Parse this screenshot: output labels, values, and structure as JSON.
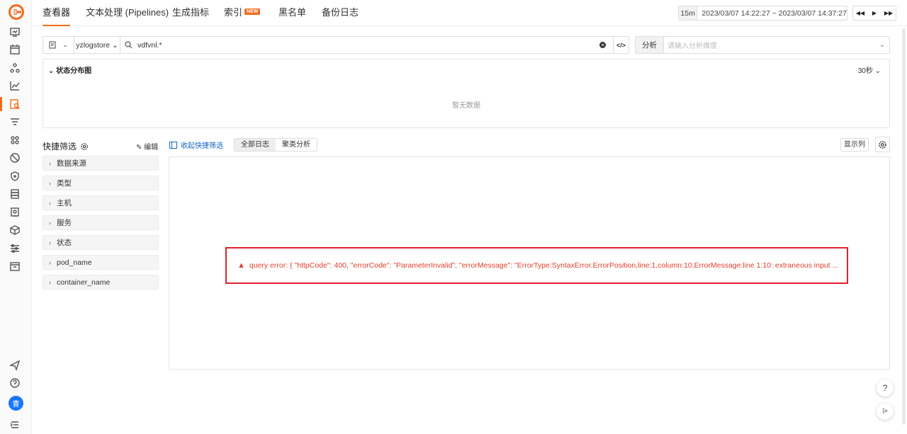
{
  "nav": {
    "tabs": [
      {
        "label": "查看器"
      },
      {
        "label": "文本处理 (Pipelines)"
      },
      {
        "label": "生成指标"
      },
      {
        "label": "索引",
        "badge": "NEW"
      },
      {
        "label": "黑名单"
      },
      {
        "label": "备份日志"
      }
    ],
    "time_quick": "15m",
    "time_range": "2023/03/07 14:22:27 ~ 2023/03/07 14:37:27"
  },
  "search": {
    "store": "yzlogstore",
    "query": "vdfvnl.*",
    "analysis_label": "分析",
    "analysis_placeholder": "请输入分析维度"
  },
  "distribution": {
    "title": "状态分布图",
    "interval": "30秒",
    "empty_text": "暂无数据"
  },
  "quick_filter": {
    "title": "快捷筛选",
    "edit_label": "编辑",
    "items": [
      "数据来源",
      "类型",
      "主机",
      "服务",
      "状态",
      "pod_name",
      "container_name"
    ]
  },
  "log": {
    "collapse_label": "收起快捷筛选",
    "tab_all": "全部日志",
    "tab_cluster": "聚类分析",
    "columns_label": "显示列",
    "error_text": "query error: { \"httpCode\": 400, \"errorCode\": \"ParameterInvalid\", \"errorMessage\": \"ErrorType:SyntaxError.ErrorPosition,line:1,column:10,ErrorMessage:line 1:10: extraneous input ..."
  },
  "user": {
    "avatar_text": "曹"
  },
  "colors": {
    "accent": "#f26b1d",
    "error": "#e0202f",
    "link": "#1565c0"
  }
}
